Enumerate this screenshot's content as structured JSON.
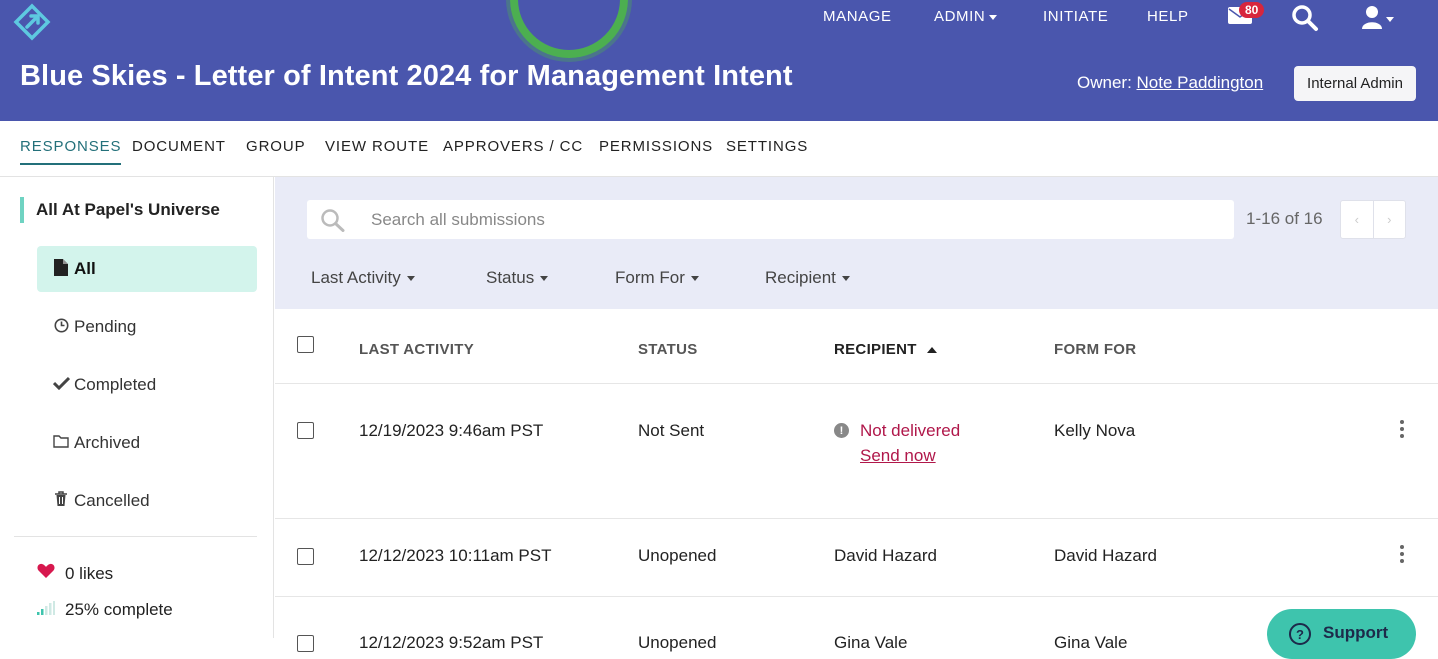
{
  "header": {
    "title": "Blue Skies - Letter of Intent 2024 for Management Intent",
    "nav": {
      "manage": "MANAGE",
      "admin": "ADMIN",
      "initiate": "INITIATE",
      "help": "HELP"
    },
    "mail_count": "80",
    "owner_label": "Owner:",
    "owner_name": "Note Paddington",
    "admin_button": "Internal Admin"
  },
  "tabs": {
    "responses": "RESPONSES",
    "document": "DOCUMENT",
    "group": "GROUP",
    "view_route": "VIEW ROUTE",
    "approvers": "APPROVERS / CC",
    "permissions": "PERMISSIONS",
    "settings": "SETTINGS"
  },
  "sidebar": {
    "heading": "All At Papel's Universe",
    "items": [
      {
        "label": "All",
        "icon": "file-icon"
      },
      {
        "label": "Pending",
        "icon": "clock-icon"
      },
      {
        "label": "Completed",
        "icon": "check-icon"
      },
      {
        "label": "Archived",
        "icon": "folder-icon"
      },
      {
        "label": "Cancelled",
        "icon": "trash-icon"
      }
    ],
    "likes": "0 likes",
    "complete": "25% complete"
  },
  "search": {
    "placeholder": "Search all submissions",
    "pager": "1-16 of 16"
  },
  "filters": {
    "last_activity": "Last Activity",
    "status": "Status",
    "form_for": "Form For",
    "recipient": "Recipient"
  },
  "table": {
    "headers": {
      "last_activity": "LAST ACTIVITY",
      "status": "STATUS",
      "recipient": "RECIPIENT",
      "form_for": "FORM FOR"
    },
    "rows": [
      {
        "last_activity": "12/19/2023 9:46am PST",
        "status": "Not Sent",
        "recipient_error": "Not delivered",
        "recipient_action": "Send now",
        "form_for": "Kelly Nova"
      },
      {
        "last_activity": "12/12/2023 10:11am PST",
        "status": "Unopened",
        "recipient": "David Hazard",
        "form_for": "David Hazard"
      },
      {
        "last_activity": "12/12/2023 9:52am PST",
        "status": "Unopened",
        "recipient": "Gina Vale",
        "form_for": "Gina Vale"
      }
    ]
  },
  "support": {
    "label": "Support"
  },
  "colors": {
    "header_bg": "#4a56ad",
    "accent": "#23707a",
    "active_item_bg": "#d3f4ec",
    "error": "#b0174a",
    "support_bg": "#3ec4ad"
  }
}
